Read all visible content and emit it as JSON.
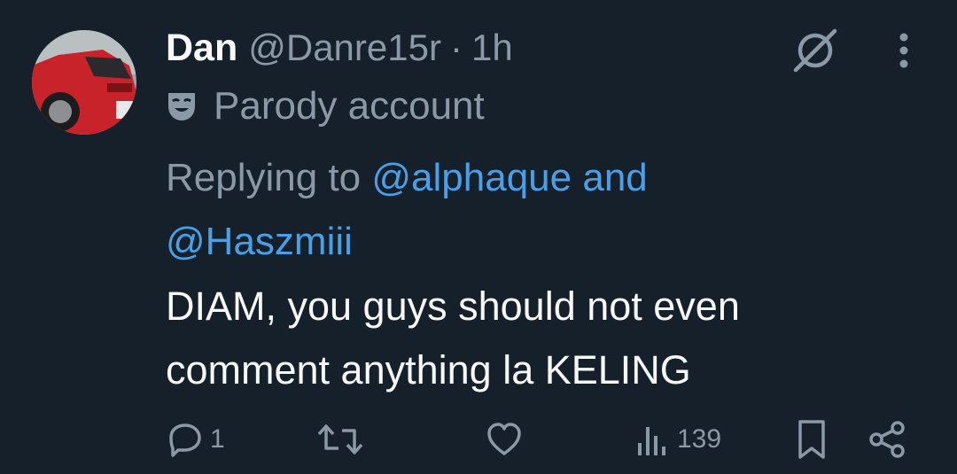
{
  "author": {
    "name": "Dan",
    "handle": "@Danre15r",
    "separator": "·",
    "time": "1h",
    "badge_text": "Parody account",
    "avatar": "red-car-photo"
  },
  "reply": {
    "prefix": "Replying to",
    "mention_1": "@alphaque",
    "conjunction": "and",
    "mention_2": "@Haszmiii"
  },
  "body": {
    "line_1": "DIAM, you guys should not even",
    "line_2": "comment anything la KELING"
  },
  "actions": {
    "reply_count": "1",
    "views_count": "139"
  },
  "icons": {
    "badge": "parody-mask-icon",
    "top_right": "slashed-circle-icon",
    "menu": "more-vertical-icon",
    "reply": "reply-icon",
    "retweet": "retweet-icon",
    "like": "heart-icon",
    "views": "views-bar-icon",
    "bookmark": "bookmark-icon",
    "share": "share-icon"
  },
  "colors": {
    "background": "#15202b",
    "primary_text": "#f7f9f9",
    "secondary_text": "#8b98a5",
    "link": "#4a9fe6"
  }
}
